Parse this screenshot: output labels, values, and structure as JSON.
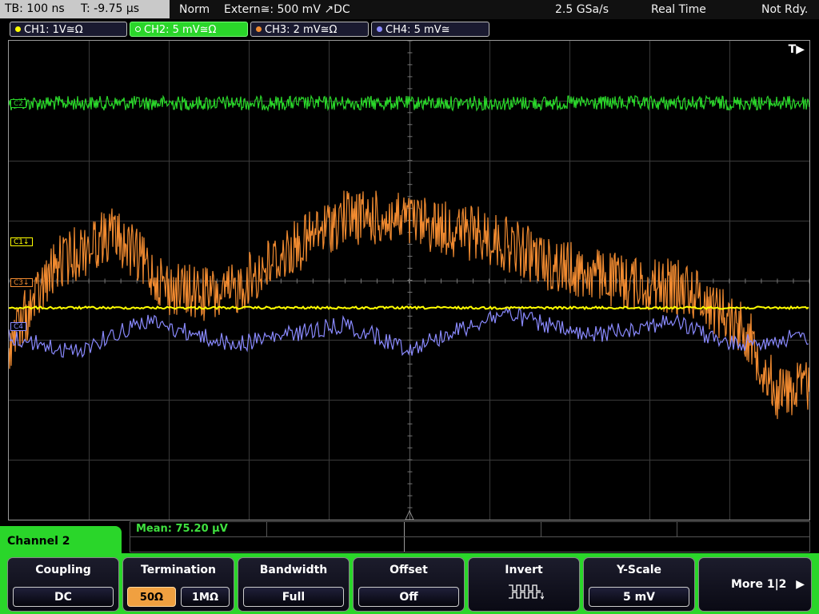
{
  "status_bar": {
    "timebase": "TB: 100 ns",
    "trigger_time": "T: -9.75 µs",
    "mode": "Norm",
    "trigger": "Extern≅: 500 mV ↗DC",
    "sample_rate": "2.5 GSa/s",
    "acq_mode": "Real Time",
    "state": "Not Rdy."
  },
  "channels": [
    {
      "id": "ch1",
      "label": "CH1: 1V≅Ω",
      "color": "#ffff00",
      "marker": "C1↓",
      "active": false
    },
    {
      "id": "ch2",
      "label": "CH2: 5 mV≅Ω",
      "color": "#2ad62a",
      "marker": "C2",
      "active": true
    },
    {
      "id": "ch3",
      "label": "CH3: 2 mV≅Ω",
      "color": "#f08a30",
      "marker": "C3↓",
      "active": false
    },
    {
      "id": "ch4",
      "label": "CH4: 5 mV≅",
      "color": "#8a8aff",
      "marker": "C4",
      "active": false
    }
  ],
  "trigger_marker": "T▶",
  "measurement": {
    "mean": "Mean: 75.20 µV"
  },
  "menu": {
    "title": "Channel 2",
    "coupling": {
      "title": "Coupling",
      "value": "DC"
    },
    "termination": {
      "title": "Termination",
      "options": [
        "50Ω",
        "1MΩ"
      ],
      "selected": "50Ω"
    },
    "bandwidth": {
      "title": "Bandwidth",
      "value": "Full"
    },
    "offset": {
      "title": "Offset",
      "value": "Off"
    },
    "invert": {
      "title": "Invert",
      "icon": "invert-waveform-icon"
    },
    "yscale": {
      "title": "Y-Scale",
      "value": "5 mV"
    },
    "more": {
      "label": "More 1|2",
      "icon": "right-arrow-icon"
    }
  }
}
